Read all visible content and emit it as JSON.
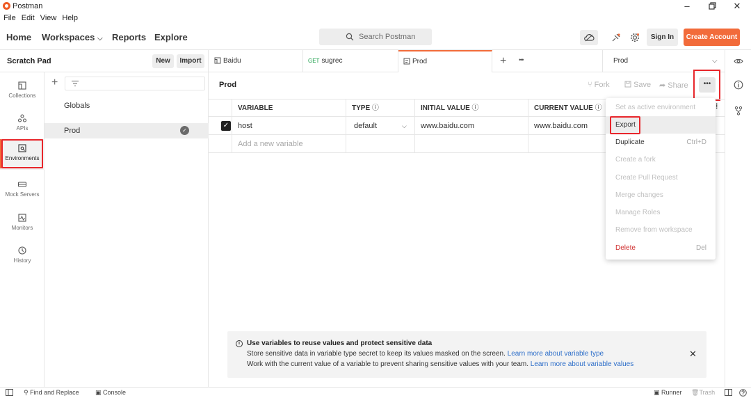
{
  "window": {
    "title": "Postman"
  },
  "menu": [
    "File",
    "Edit",
    "View",
    "Help"
  ],
  "nav": {
    "home": "Home",
    "workspaces": "Workspaces",
    "reports": "Reports",
    "explore": "Explore"
  },
  "search": {
    "placeholder": "Search Postman"
  },
  "header": {
    "sign_in": "Sign In",
    "create_account": "Create Account"
  },
  "workspace": {
    "title": "Scratch Pad",
    "new_label": "New",
    "import_label": "Import"
  },
  "rail": [
    {
      "label": "Collections",
      "icon": "collections-icon"
    },
    {
      "label": "APIs",
      "icon": "apis-icon"
    },
    {
      "label": "Environments",
      "icon": "environments-icon",
      "active": true
    },
    {
      "label": "Mock Servers",
      "icon": "mock-servers-icon"
    },
    {
      "label": "Monitors",
      "icon": "monitors-icon"
    },
    {
      "label": "History",
      "icon": "history-icon"
    }
  ],
  "env_list": [
    {
      "name": "Globals",
      "selected": false
    },
    {
      "name": "Prod",
      "selected": true
    }
  ],
  "tabs": [
    {
      "label": "Baidu",
      "method": ""
    },
    {
      "label": "sugrec",
      "method": "GET"
    },
    {
      "label": "Prod",
      "method": ""
    }
  ],
  "env_select": {
    "value": "Prod"
  },
  "main": {
    "title": "Prod",
    "fork": "Fork",
    "save": "Save",
    "share": "Share",
    "more": "•••"
  },
  "table": {
    "headers": [
      "VARIABLE",
      "TYPE",
      "INITIAL VALUE",
      "CURRENT VALUE"
    ],
    "rows": [
      {
        "variable": "host",
        "type": "default",
        "initial": "www.baidu.com",
        "current": "www.baidu.com",
        "checked": true
      }
    ],
    "add_placeholder": "Add a new variable"
  },
  "dropdown": {
    "items": [
      {
        "label": "Set as active environment",
        "shortcut": "",
        "enabled": false
      },
      {
        "label": "Export",
        "shortcut": "",
        "enabled": true
      },
      {
        "label": "Duplicate",
        "shortcut": "Ctrl+D",
        "enabled": true
      },
      {
        "label": "Create a fork",
        "shortcut": "",
        "enabled": false
      },
      {
        "label": "Create Pull Request",
        "shortcut": "",
        "enabled": false
      },
      {
        "label": "Merge changes",
        "shortcut": "",
        "enabled": false
      },
      {
        "label": "Manage Roles",
        "shortcut": "",
        "enabled": false
      },
      {
        "label": "Remove from workspace",
        "shortcut": "",
        "enabled": false
      },
      {
        "label": "Delete",
        "shortcut": "Del",
        "enabled": true
      }
    ]
  },
  "banner": {
    "title": "Use variables to reuse values and protect sensitive data",
    "line1_text": "Store sensitive data in variable type secret to keep its values masked on the screen. ",
    "line1_link": "Learn more about variable type",
    "line2_text": "Work with the current value of a variable to prevent sharing sensitive values with your team. ",
    "line2_link": "Learn more about variable values"
  },
  "footer": {
    "find_replace": "Find and Replace",
    "console": "Console",
    "runner": "Runner",
    "trash": "Trash"
  },
  "colors": {
    "accent": "#f26b3a",
    "highlight": "#e8262b",
    "link": "#2d6ec9",
    "danger": "#d02f2f",
    "get_method": "#1a9e4a"
  }
}
